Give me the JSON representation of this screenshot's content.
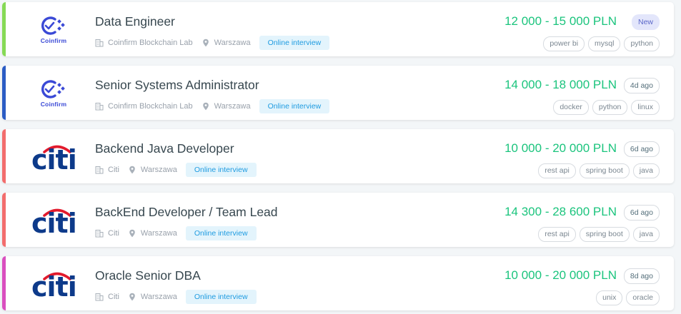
{
  "offers": [
    {
      "title": "Data Engineer",
      "company": "Coinfirm Blockchain Lab",
      "city": "Warszawa",
      "interview": "Online interview",
      "salary": "12 000 - 15 000 PLN",
      "age": "New",
      "is_new": true,
      "accent_color": "#86d955",
      "logo_icon": "coinfirm-logo-icon",
      "logo_text": "Coinfirm",
      "tags": [
        "power bi",
        "mysql",
        "python"
      ]
    },
    {
      "title": "Senior Systems Administrator",
      "company": "Coinfirm Blockchain Lab",
      "city": "Warszawa",
      "interview": "Online interview",
      "salary": "14 000 - 18 000 PLN",
      "age": "4d ago",
      "is_new": false,
      "accent_color": "#2b5cc4",
      "logo_icon": "coinfirm-logo-icon",
      "logo_text": "Coinfirm",
      "tags": [
        "docker",
        "python",
        "linux"
      ]
    },
    {
      "title": "Backend Java Developer",
      "company": "Citi",
      "city": "Warszawa",
      "interview": "Online interview",
      "salary": "10 000 - 20 000 PLN",
      "age": "6d ago",
      "is_new": false,
      "accent_color": "#f26d6d",
      "logo_icon": "citi-logo-icon",
      "logo_text": "citi",
      "tags": [
        "rest api",
        "spring boot",
        "java"
      ]
    },
    {
      "title": "BackEnd Developer / Team Lead",
      "company": "Citi",
      "city": "Warszawa",
      "interview": "Online interview",
      "salary": "14 300 - 28 600 PLN",
      "age": "6d ago",
      "is_new": false,
      "accent_color": "#f26d6d",
      "logo_icon": "citi-logo-icon",
      "logo_text": "citi",
      "tags": [
        "rest api",
        "spring boot",
        "java"
      ]
    },
    {
      "title": "Oracle Senior DBA",
      "company": "Citi",
      "city": "Warszawa",
      "interview": "Online interview",
      "salary": "10 000 - 20 000 PLN",
      "age": "8d ago",
      "is_new": false,
      "accent_color": "#d94fbf",
      "logo_icon": "citi-logo-icon",
      "logo_text": "citi",
      "tags": [
        "unix",
        "oracle"
      ]
    }
  ],
  "icons": {
    "company": "building-icon",
    "location": "map-pin-icon"
  },
  "colors": {
    "salary": "#1bc47d",
    "interview_badge_bg": "#e3f4fc",
    "interview_badge_text": "#1e9be0",
    "new_badge_bg": "#e3e6fb",
    "coinfirm_brand": "#3a49d6",
    "citi_blue": "#0d3a8a",
    "citi_red": "#e21a2c"
  }
}
